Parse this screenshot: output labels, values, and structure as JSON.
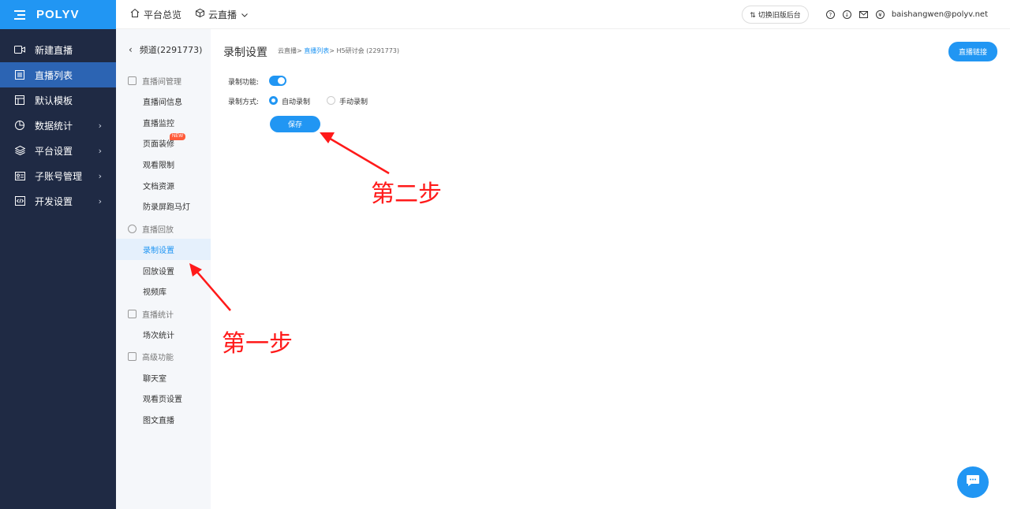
{
  "brand": {
    "logo": "POLYV"
  },
  "sidebar": {
    "items": [
      {
        "label": "新建直播",
        "icon": "video-icon"
      },
      {
        "label": "直播列表",
        "icon": "list-icon",
        "active": true
      },
      {
        "label": "默认模板",
        "icon": "template-icon"
      },
      {
        "label": "数据统计",
        "icon": "chart-icon",
        "chevron": "›"
      },
      {
        "label": "平台设置",
        "icon": "layers-icon",
        "chevron": "›"
      },
      {
        "label": "子账号管理",
        "icon": "id-card-icon",
        "chevron": "›"
      },
      {
        "label": "开发设置",
        "icon": "code-icon",
        "chevron": "›"
      }
    ]
  },
  "topbar": {
    "overview": "平台总览",
    "cloud_live": "云直播",
    "switch_old": "切换旧版后台",
    "user_email": "baishangwen@polyv.net"
  },
  "subnav": {
    "back_label": "频道(2291773)",
    "groups": [
      {
        "title": "直播间管理",
        "items": [
          "直播间信息",
          "直播监控",
          "页面装修",
          "观看限制",
          "文档资源",
          "防录屏跑马灯"
        ]
      },
      {
        "title": "直播回放",
        "items": [
          "录制设置",
          "回放设置",
          "视频库"
        ]
      },
      {
        "title": "直播统计",
        "items": [
          "场次统计"
        ]
      },
      {
        "title": "高级功能",
        "items": [
          "聊天室",
          "观看页设置",
          "图文直播"
        ]
      }
    ],
    "new_badge": "NEW"
  },
  "main": {
    "title": "录制设置",
    "breadcrumb": {
      "root": "云直播",
      "sep": ">",
      "list": "直播列表",
      "current": "H5研讨会 (2291773)"
    },
    "live_link_button": "直播链接",
    "record_function_label": "录制功能:",
    "record_mode_label": "录制方式:",
    "record_mode_options": [
      "自动录制",
      "手动录制"
    ],
    "record_mode_selected": "自动录制",
    "record_enabled": true,
    "save_button": "保存"
  },
  "annotations": {
    "step1": "第一步",
    "step2": "第二步"
  },
  "colors": {
    "accent": "#2196f3",
    "sidebar_bg": "#1f2a44",
    "annotation": "#ff1a1a"
  }
}
